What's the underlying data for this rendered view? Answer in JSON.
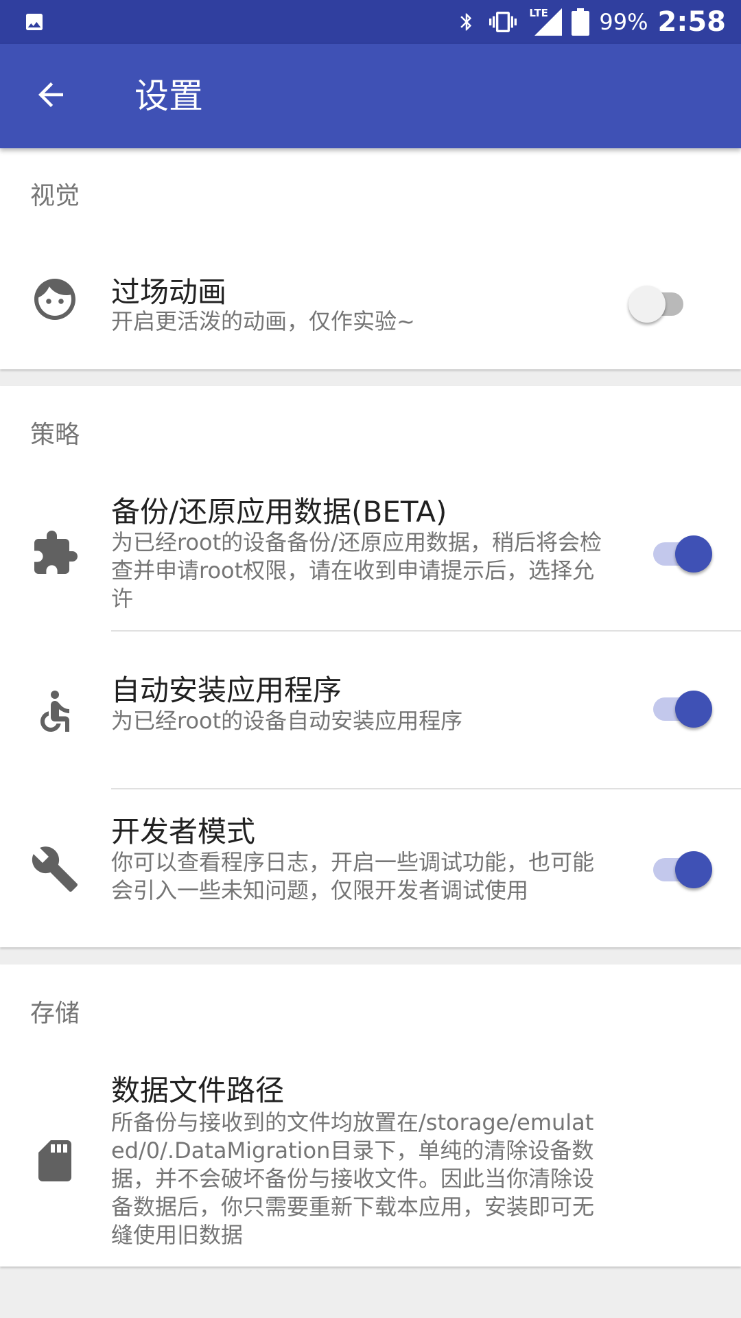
{
  "status_bar": {
    "battery_percent": "99%",
    "time": "2:58",
    "network_label": "LTE"
  },
  "app_bar": {
    "title": "设置"
  },
  "sections": {
    "visual": {
      "header": "视觉",
      "transition": {
        "title": "过场动画",
        "summary": "开启更活泼的动画，仅作实验~",
        "enabled": false
      }
    },
    "strategy": {
      "header": "策略",
      "backup": {
        "title": "备份/还原应用数据(BETA)",
        "summary": "为已经root的设备备份/还原应用数据，稍后将会检查并申请root权限，请在收到申请提示后，选择允许",
        "enabled": true
      },
      "auto_install": {
        "title": "自动安装应用程序",
        "summary": "为已经root的设备自动安装应用程序",
        "enabled": true
      },
      "developer": {
        "title": "开发者模式",
        "summary": "你可以查看程序日志，开启一些调试功能，也可能会引入一些未知问题，仅限开发者调试使用",
        "enabled": true
      }
    },
    "storage": {
      "header": "存储",
      "data_path": {
        "title": "数据文件路径",
        "summary": "所备份与接收到的文件均放置在/storage/emulated/0/.DataMigration目录下，单纯的清除设备数据，并不会破坏备份与接收文件。因此当你清除设备数据后，你只需要重新下载本应用，安装即可无缝使用旧数据"
      }
    }
  },
  "icons": {
    "status_left": "image-icon",
    "bluetooth": "bluetooth-icon",
    "vibrate": "vibrate-icon",
    "signal": "lte-signal-icon",
    "battery": "battery-icon",
    "back": "arrow-back-icon",
    "transition": "face-icon",
    "backup": "puzzle-piece-icon",
    "auto_install": "accessibility-icon",
    "developer": "wrench-icon",
    "data_path": "sd-card-icon"
  },
  "colors": {
    "status_bar": "#303f9f",
    "app_bar": "#3f51b5",
    "accent": "#3f51b5",
    "switch_track_on": "#c3c8ec",
    "icon": "#616161"
  }
}
